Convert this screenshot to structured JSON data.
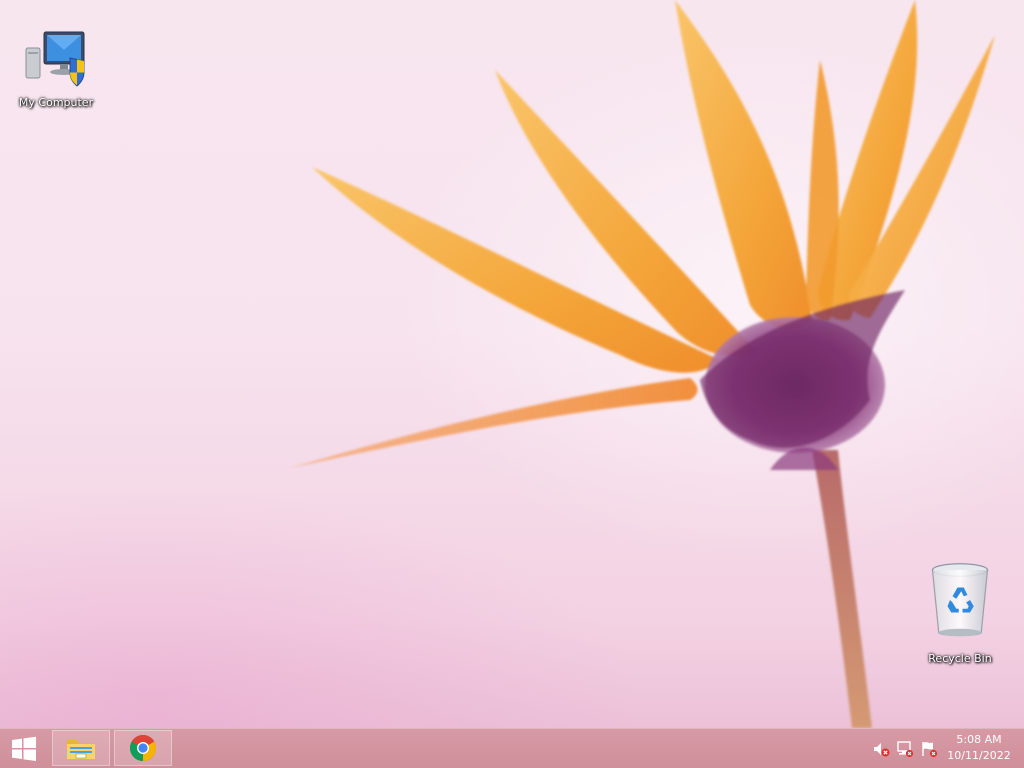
{
  "desktop": {
    "icons": [
      {
        "label": "My Computer",
        "icon": "computer-shield-icon"
      },
      {
        "label": "Recycle Bin",
        "icon": "recycle-bin-icon"
      }
    ]
  },
  "taskbar": {
    "start_icon": "windows-logo-icon",
    "pinned": [
      {
        "name": "file-explorer",
        "icon": "folder-icon"
      },
      {
        "name": "chrome",
        "icon": "chrome-icon"
      }
    ],
    "tray": {
      "icons": [
        "volume-muted-icon",
        "network-icon",
        "action-center-flag-icon"
      ],
      "time": "5:08 AM",
      "date": "10/11/2022"
    }
  },
  "colors": {
    "taskbar": "#d79aa5",
    "wallpaper_bg": "#f7e3ee",
    "petal": "#f5b042",
    "flower_center": "#7a2a6a"
  }
}
